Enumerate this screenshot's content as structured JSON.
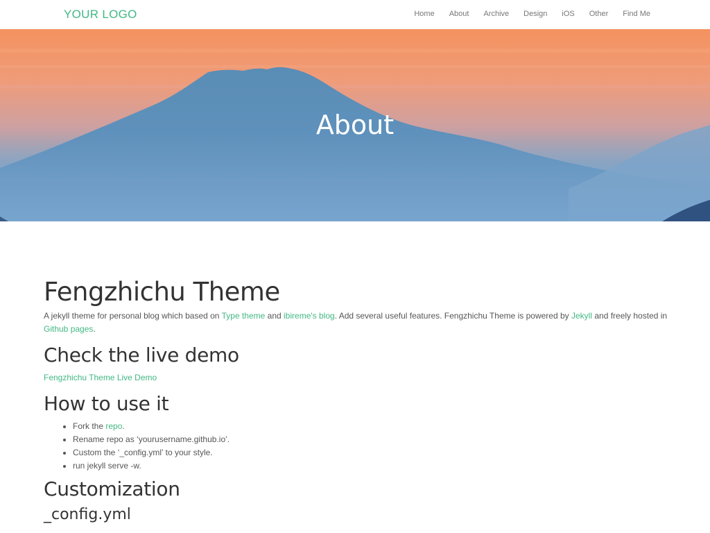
{
  "header": {
    "logo": "YOUR LOGO",
    "nav": [
      "Home",
      "About",
      "Archive",
      "Design",
      "iOS",
      "Other",
      "Find Me"
    ]
  },
  "hero": {
    "title": "About"
  },
  "content": {
    "title": "Fengzhichu Theme",
    "intro": {
      "t1": "A jekyll theme for personal blog which based on ",
      "l1": "Type theme",
      "t2": " and ",
      "l2": "ibireme's blog",
      "t3": ". Add several useful features. Fengzhichu Theme is powered by ",
      "l3": "Jekyll",
      "t4": " and freely hosted in ",
      "l4": "Github pages",
      "t5": "."
    },
    "demo": {
      "heading": "Check the live demo",
      "link": "Fengzhichu Theme Live Demo"
    },
    "howto": {
      "heading": "How to use it",
      "item1_prefix": "Fork the ",
      "item1_link": "repo",
      "item1_suffix": ".",
      "item2": "Rename repo as ‘yourusername.github.io’.",
      "item3": "Custom the ‘_config.yml’ to your style.",
      "item4": "run jekyll serve -w."
    },
    "custom": {
      "heading": "Customization",
      "sub": "_config.yml"
    }
  },
  "colors": {
    "accent": "#41b883",
    "sky_top": "#f2956a",
    "mountain": "#5e8fb5"
  }
}
